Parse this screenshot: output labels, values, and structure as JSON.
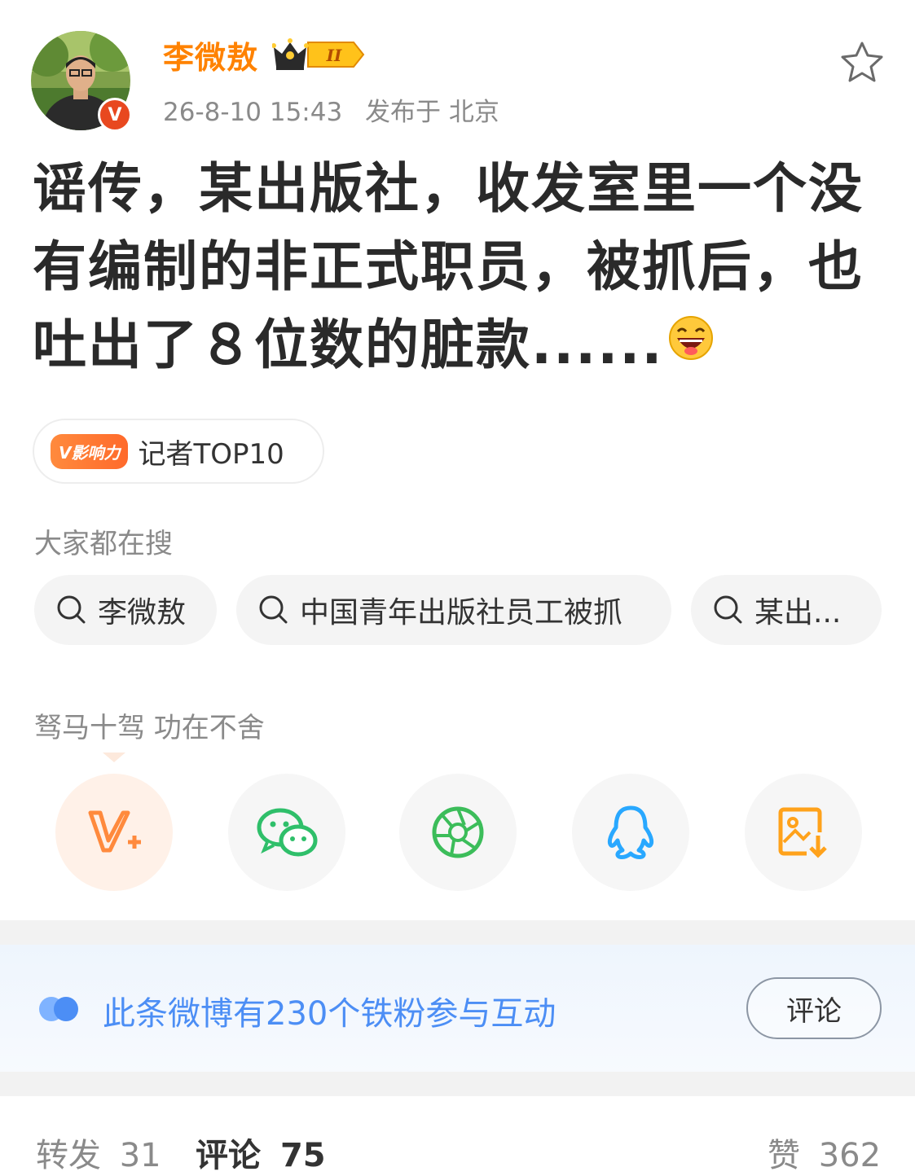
{
  "user": {
    "name": "李微敖",
    "level_badge": "II",
    "verified_mark": "V"
  },
  "meta": {
    "time": "26-8-10 15:43",
    "location": "发布于 北京"
  },
  "post": {
    "text": "谣传，某出版社，收发室里一个没有编制的非正式职员，被抓后，也吐出了８位数的脏款......"
  },
  "influence": {
    "badge": "V影响力",
    "label": "记者TOP10"
  },
  "search": {
    "title": "大家都在搜",
    "items": [
      "李微敖",
      "中国青年出版社员工被抓",
      "某出..."
    ]
  },
  "share": {
    "title": "驽马十驾 功在不舍",
    "targets": [
      {
        "name": "v-plus-icon",
        "color": "#ff8a3d"
      },
      {
        "name": "wechat-icon",
        "color": "#2fbf6a"
      },
      {
        "name": "moments-icon",
        "color": "#3cbd5a"
      },
      {
        "name": "qq-icon",
        "color": "#29a8ff"
      },
      {
        "name": "save-image-icon",
        "color": "#ffa21b"
      }
    ]
  },
  "fan_banner": {
    "text": "此条微博有230个铁粉参与互动",
    "button": "评论"
  },
  "stats": {
    "repost_label": "转发",
    "repost_count": "31",
    "comment_label": "评论",
    "comment_count": "75",
    "like_label": "赞",
    "like_count": "362"
  },
  "colors": {
    "accent": "#ff8200",
    "link": "#4c8ef5"
  }
}
